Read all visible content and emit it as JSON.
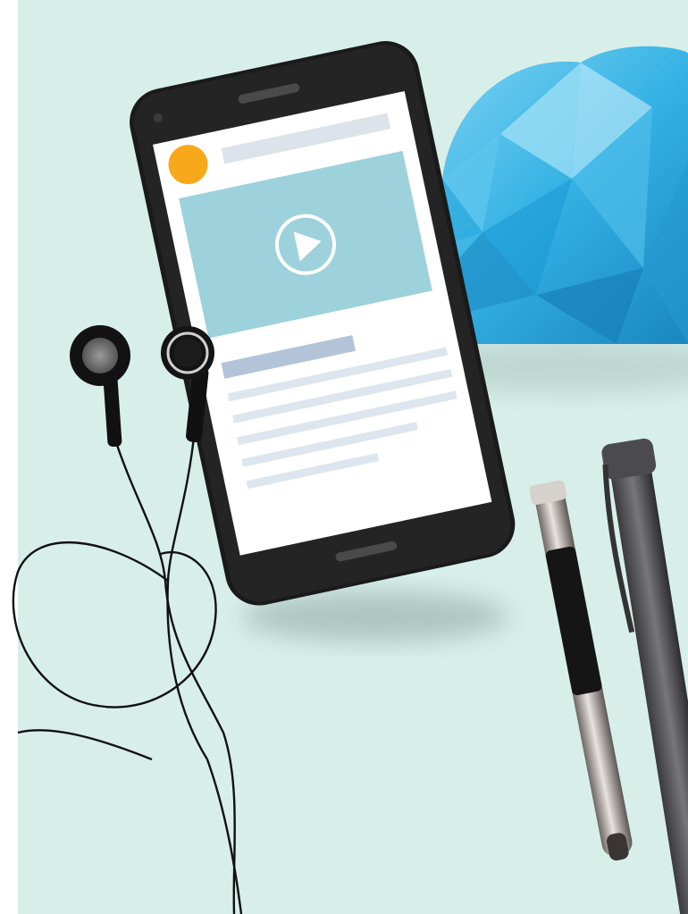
{
  "scene": {
    "description_label": "",
    "colors": {
      "background": "#d8efe9",
      "phone_body": "#1a1a1a",
      "screen": "#ffffff",
      "avatar": "#f7a81b",
      "video_panel": "#9dd2dc",
      "accent_bar": "#b3c3d8",
      "text_lines": "#dde5ef",
      "cloud_light": "#7fd3f2",
      "cloud_dark": "#1f8dc5",
      "earphones": "#111111",
      "pen_metal": "#8c8585",
      "pen_grip": "#151515"
    },
    "objects": [
      "smartphone",
      "cloud",
      "earphones",
      "pen-silver",
      "pen-black"
    ]
  }
}
